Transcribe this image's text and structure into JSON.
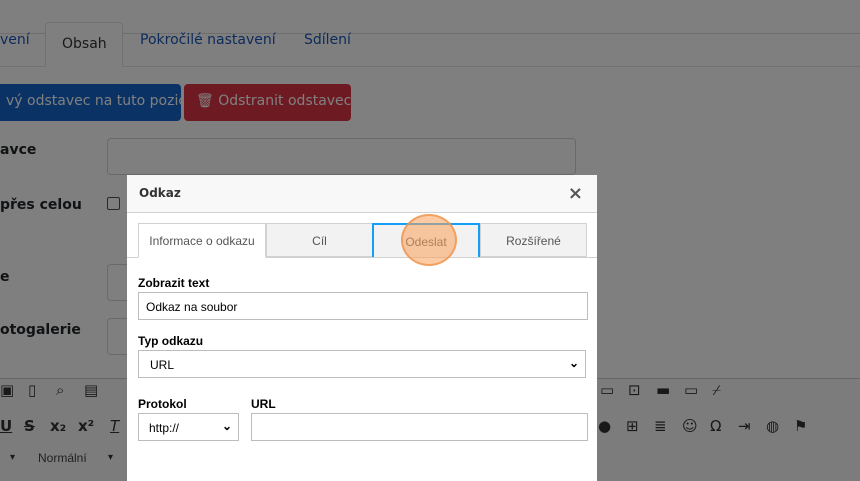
{
  "page": {
    "tabs": [
      {
        "label": "vení"
      },
      {
        "label": "Obsah"
      },
      {
        "label": "Pokročilé nastavení"
      },
      {
        "label": "Sdílení"
      }
    ],
    "add_button": "vý odstavec na tuto pozici",
    "delete_button": "Odstranit odstavec",
    "labels": [
      "avce",
      "přes celou",
      "e",
      "otogalerie"
    ],
    "format_select": "Normální"
  },
  "dialog": {
    "title": "Odkaz",
    "close": "×",
    "tabs": [
      {
        "label": "Informace o odkazu"
      },
      {
        "label": "Cíl"
      },
      {
        "label": "Odeslat"
      },
      {
        "label": "Rozšířené"
      }
    ],
    "display_text_label": "Zobrazit text",
    "display_text_value": "Odkaz na soubor",
    "link_type_label": "Typ odkazu",
    "link_type_value": "URL",
    "protocol_label": "Protokol",
    "protocol_value": "http://",
    "url_label": "URL",
    "url_value": ""
  }
}
